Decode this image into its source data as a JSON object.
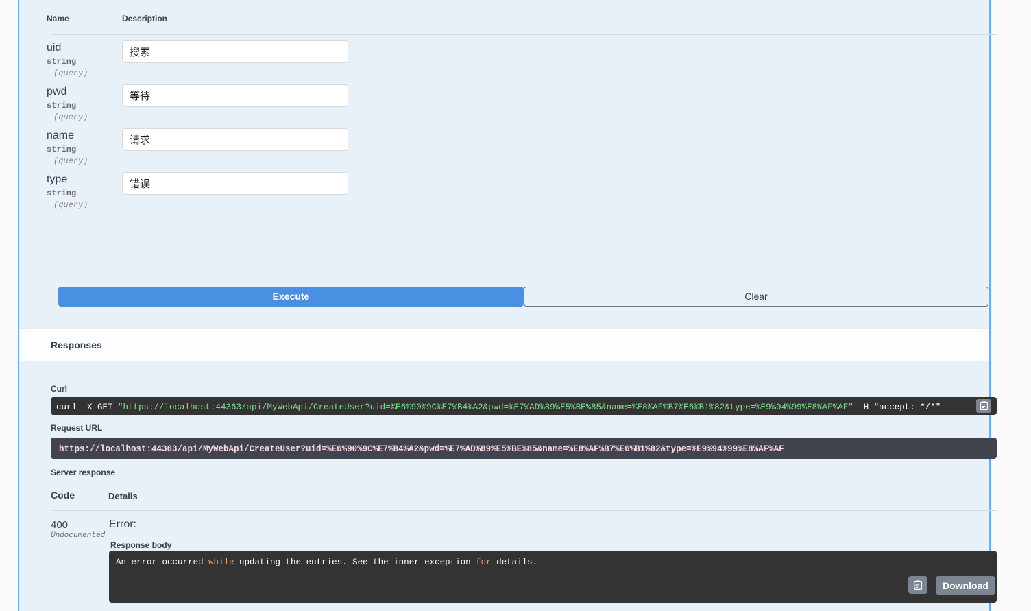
{
  "params_table": {
    "columns": {
      "name": "Name",
      "description": "Description"
    },
    "rows": [
      {
        "name": "uid",
        "type": "string",
        "in": "(query)",
        "value": "搜索"
      },
      {
        "name": "pwd",
        "type": "string",
        "in": "(query)",
        "value": "等待"
      },
      {
        "name": "name",
        "type": "string",
        "in": "(query)",
        "value": "请求"
      },
      {
        "name": "type",
        "type": "string",
        "in": "(query)",
        "value": "错误"
      }
    ]
  },
  "actions": {
    "execute_label": "Execute",
    "clear_label": "Clear",
    "execute_color": "#4990e2"
  },
  "responses": {
    "section_title": "Responses",
    "curl_label": "Curl",
    "curl_prefix": "curl -X GET ",
    "curl_url": "\"https://localhost:44363/api/MyWebApi/CreateUser?uid=%E6%90%9C%E7%B4%A2&pwd=%E7%AD%89%E5%BE%85&name=%E8%AF%B7%E6%B1%82&type=%E9%94%99%E8%AF%AF\"",
    "curl_suffix": " -H  \"accept: */*\"",
    "request_url_label": "Request URL",
    "request_url": "https://localhost:44363/api/MyWebApi/CreateUser?uid=%E6%90%9C%E7%B4%A2&pwd=%E7%AD%89%E5%BE%85&name=%E8%AF%B7%E6%B1%82&type=%E9%94%99%E8%AF%AF",
    "server_response_label": "Server response",
    "code_header": "Code",
    "details_header": "Details",
    "code": "400",
    "code_note": "Undocumented",
    "error_title": "Error:",
    "response_body_label": "Response body",
    "response_body_pre": "An error occurred ",
    "response_body_kw1": "while",
    "response_body_mid": " updating the entries. See the inner exception ",
    "response_body_kw2": "for",
    "response_body_post": " details.",
    "download_label": "Download"
  }
}
